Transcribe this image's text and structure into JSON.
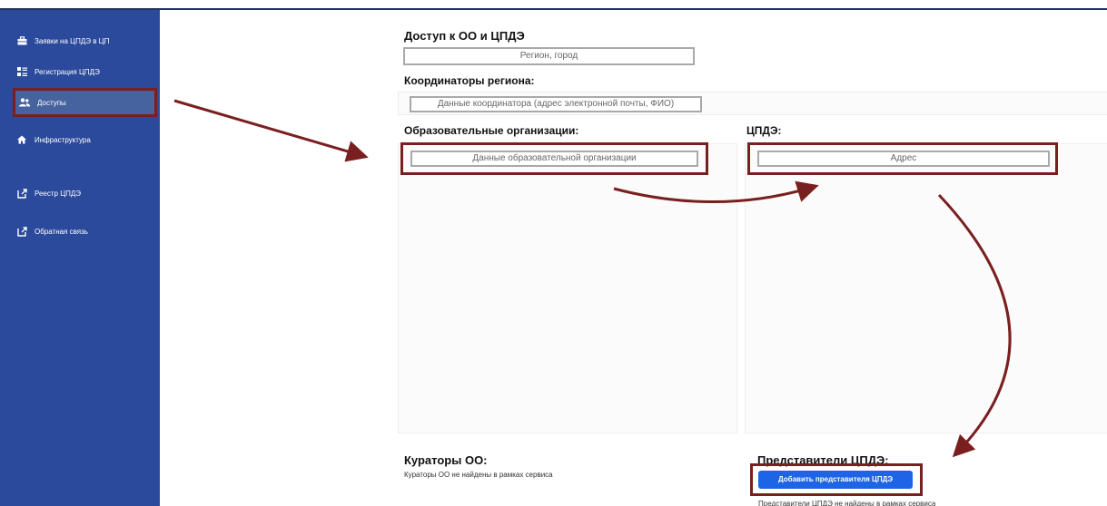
{
  "sidebar": {
    "items": [
      {
        "label": "Заявки на ЦПДЭ в ЦП",
        "icon": "briefcase-icon"
      },
      {
        "label": "Регистрация ЦПДЭ",
        "icon": "list-icon"
      },
      {
        "label": "Доступы",
        "icon": "users-icon",
        "active": true
      },
      {
        "label": "Инфраструктура",
        "icon": "home-icon"
      },
      {
        "label": "Реестр ЦПДЭ",
        "icon": "external-link-icon"
      },
      {
        "label": "Обратная связь",
        "icon": "external-link-icon"
      }
    ]
  },
  "main": {
    "access_title": "Доступ к ОО и ЦПДЭ",
    "region_placeholder": "Регион, город",
    "coordinators_title": "Координаторы региона:",
    "coordinator_placeholder": "Данные координатора (адрес электронной почты, ФИО)",
    "orgs_title": "Образовательные организации:",
    "org_placeholder": "Данные образовательной организации",
    "cpde_title": "ЦПДЭ:",
    "address_placeholder": "Адрес",
    "curators_title": "Кураторы ОО:",
    "curators_empty": "Кураторы ОО не найдены в рамках сервиса",
    "reps_title": "Представители ЦПДЭ:",
    "add_rep_button": "Добавить представителя ЦПДЭ",
    "reps_empty": "Представители ЦПДЭ не найдены в рамках сервиса"
  },
  "colors": {
    "sidebar": "#2b4a9c",
    "annotation": "#7a1f1f",
    "button": "#1e64e6"
  }
}
